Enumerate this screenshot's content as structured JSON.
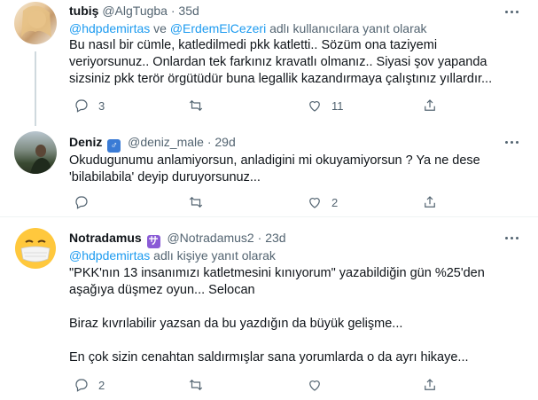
{
  "tweets": [
    {
      "name": "tubiş",
      "handle": "@AlgTugba",
      "dot": "·",
      "time": "35d",
      "reply_to": [
        "@hdpdemirtas",
        " ve ",
        "@ErdemElCezeri",
        " adlı kullanıcılara yanıt olarak"
      ],
      "text": "Bu nasıl bir cümle, katledilmedi pkk katletti.. Sözüm ona taziyemi\nveriyorsunuz.. Onlardan tek farkınız kravatlı olmanız.. Siyasi şov yapanda\nsizsiniz pkk terör örgütüdür buna legallik kazandırmaya çalıştınız yıllardır...",
      "counts": {
        "reply": "3",
        "retweet": "",
        "like": "11"
      }
    },
    {
      "name": "Deniz",
      "badge": "♂",
      "handle": "@deniz_male",
      "dot": "·",
      "time": "29d",
      "text": "Okudugunumu anlamiyorsun, anladigini mi okuyamiyorsun ? Ya ne dese\n'bilabilabila' deyip duruyorsunuz...",
      "counts": {
        "reply": "",
        "retweet": "",
        "like": "2"
      }
    },
    {
      "name": "Notradamus",
      "badge": "サ",
      "handle": "@Notradamus2",
      "dot": "·",
      "time": "23d",
      "reply_to": [
        "@hdpdemirtas",
        " adlı kişiye yanıt olarak"
      ],
      "text": "\"PKK'nın 13 insanımızı katletmesini kınıyorum\" yazabildiğin gün %25'den\naşağıya düşmez oyun... Selocan\n\nBiraz kıvrılabilir yazsan da bu yazdığın da büyük gelişme...\n\nEn çok sizin cenahtan saldırmışlar sana yorumlarda o da ayrı hikaye...",
      "counts": {
        "reply": "2",
        "retweet": "",
        "like": ""
      }
    }
  ],
  "colors": {
    "link": "#1d9bf0",
    "muted": "#536471",
    "text": "#0f1419"
  },
  "icons": [
    "reply-icon",
    "retweet-icon",
    "like-icon",
    "share-icon",
    "more-icon"
  ]
}
